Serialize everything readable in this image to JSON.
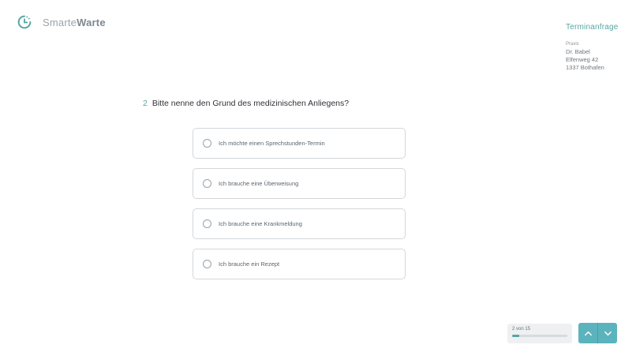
{
  "brand": {
    "name_light": "Smarte",
    "name_bold": "Warte"
  },
  "side": {
    "title": "Terminanfrage",
    "practice_label": "Praxis",
    "doctor": "Dr. Babel",
    "street": "Elfenweg 42",
    "city": "1337 Bothafen"
  },
  "question": {
    "number": "2",
    "text": "Bitte nenne den Grund des medizinischen Anliegens?"
  },
  "options": [
    {
      "label": "Ich möchte einen Sprechstunden-Termin"
    },
    {
      "label": "Ich brauche eine Überweisung"
    },
    {
      "label": "Ich brauche eine Krankmeldung"
    },
    {
      "label": "Ich brauche ein Rezept"
    }
  ],
  "progress": {
    "text": "2 von 15",
    "fraction": 0.1333
  },
  "icons": {
    "logo": "clock-arrow-icon",
    "up": "chevron-up-icon",
    "down": "chevron-down-icon"
  },
  "colors": {
    "accent": "#57a6a2",
    "nav_button": "#5bb3bd"
  }
}
